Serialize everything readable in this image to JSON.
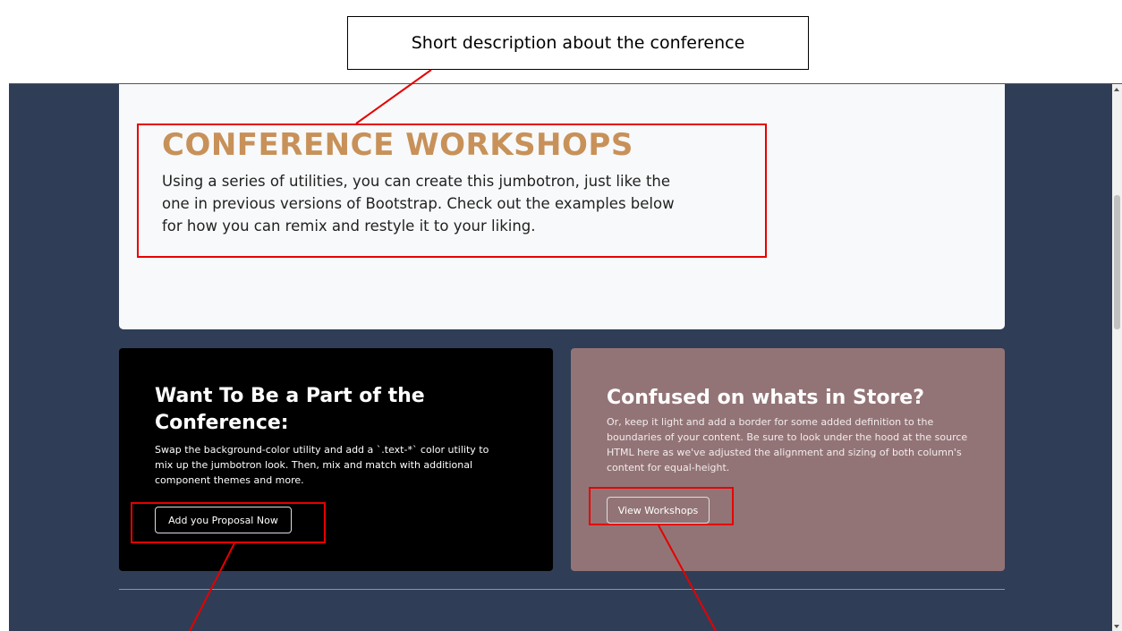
{
  "annotation": {
    "callout_text": "Short description about the conference"
  },
  "jumbotron": {
    "title": "CONFERENCE WORKSHOPS",
    "text": "Using a series of utilities, you can create this jumbotron, just like the one in previous versions of Bootstrap. Check out the examples below for how you can remix and restyle it to your liking."
  },
  "cards": {
    "left": {
      "title": "Want To Be a Part of the Conference:",
      "text": "Swap the background-color utility and add a `.text-*` color utility to mix up the jumbotron look. Then, mix and match with additional component themes and more.",
      "button_label": "Add you Proposal Now"
    },
    "right": {
      "title": "Confused on whats in Store?",
      "text": "Or, keep it light and add a border for some added definition to the boundaries of your content. Be sure to look under the hood at the source HTML here as we've adjusted the alignment and sizing of both column's content for equal-height.",
      "button_label": "View Workshops"
    }
  },
  "colors": {
    "page_background": "#2f3e56",
    "jumbotron_background": "#f8f9fa",
    "title_accent": "#c79159",
    "left_card_background": "#000000",
    "right_card_background": "#937476",
    "annotation_red": "#e60000"
  }
}
